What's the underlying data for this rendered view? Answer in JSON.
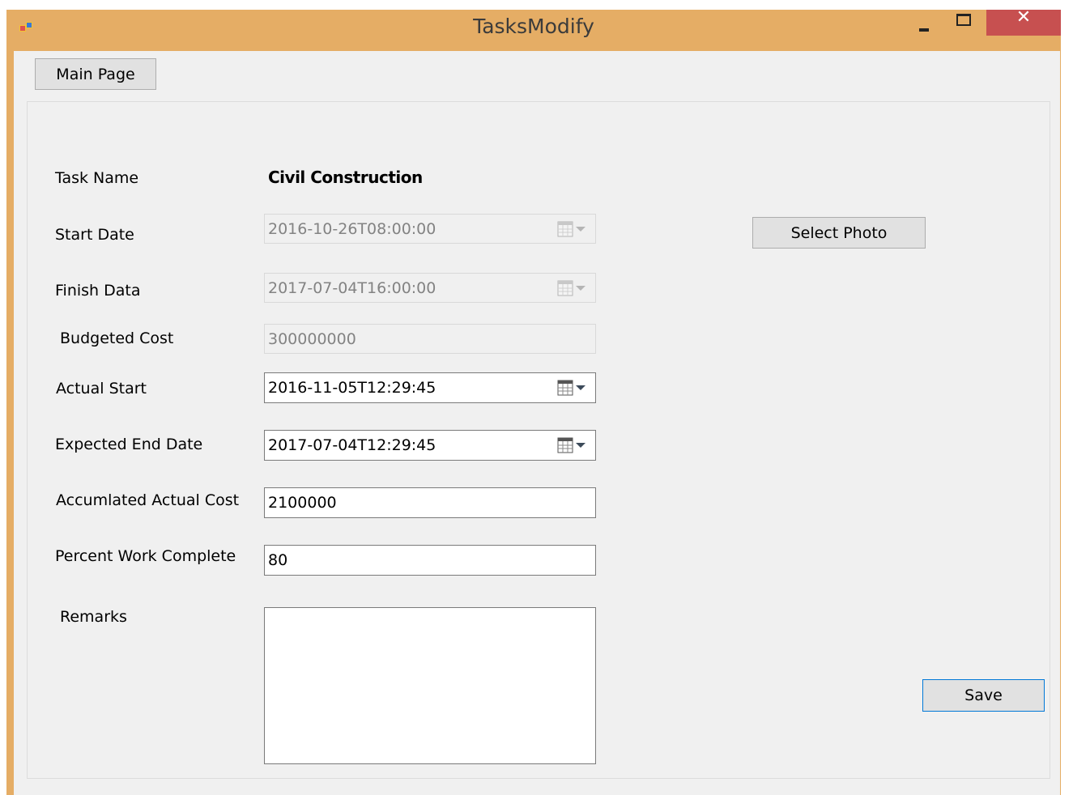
{
  "window": {
    "title": "TasksModify",
    "close_glyph": "✕"
  },
  "toolbar": {
    "main_page_label": "Main Page"
  },
  "form": {
    "task_name_label": "Task Name",
    "task_name_value": "Civil Construction",
    "start_date_label": "Start Date",
    "start_date_value": "2016-10-26T08:00:00",
    "finish_date_label": "Finish Data",
    "finish_date_value": "2017-07-04T16:00:00",
    "budgeted_cost_label": "Budgeted Cost",
    "budgeted_cost_value": "300000000",
    "actual_start_label": "Actual Start",
    "actual_start_value": "2016-11-05T12:29:45",
    "expected_end_label": "Expected End Date",
    "expected_end_value": "2017-07-04T12:29:45",
    "accumulated_cost_label": "Accumlated Actual Cost",
    "accumulated_cost_value": "2100000",
    "percent_complete_label": "Percent Work Complete",
    "percent_complete_value": "80",
    "remarks_label": "Remarks",
    "remarks_value": ""
  },
  "buttons": {
    "select_photo_label": "Select Photo",
    "save_label": "Save"
  },
  "icons": {
    "app": "app-window-icon",
    "calendar": "calendar-dropdown-icon"
  },
  "colors": {
    "title_bar": "#e5ad65",
    "close_button": "#c75050",
    "client_background": "#f0f0f0"
  }
}
